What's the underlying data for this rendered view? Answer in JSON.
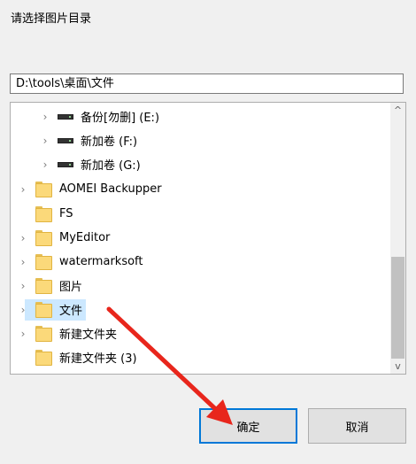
{
  "prompt": "请选择图片目录",
  "path": "D:\\tools\\桌面\\文件",
  "tree": {
    "items": [
      {
        "label": "备份[勿删] (E:)",
        "type": "drive",
        "chevron": "›"
      },
      {
        "label": "新加卷 (F:)",
        "type": "drive",
        "chevron": "›"
      },
      {
        "label": "新加卷 (G:)",
        "type": "drive",
        "chevron": "›"
      },
      {
        "label": "AOMEI Backupper",
        "type": "folder",
        "chevron": "›"
      },
      {
        "label": "FS",
        "type": "folder",
        "chevron": ""
      },
      {
        "label": "MyEditor",
        "type": "folder",
        "chevron": "›"
      },
      {
        "label": "watermarksoft",
        "type": "folder",
        "chevron": "›"
      },
      {
        "label": "图片",
        "type": "folder",
        "chevron": "›"
      },
      {
        "label": "文件",
        "type": "folder",
        "chevron": "›",
        "selected": true
      },
      {
        "label": "新建文件夹",
        "type": "folder",
        "chevron": "›"
      },
      {
        "label": "新建文件夹 (3)",
        "type": "folder",
        "chevron": ""
      }
    ]
  },
  "scroll": {
    "up_glyph": "^",
    "down_glyph": "v"
  },
  "buttons": {
    "ok": "确定",
    "cancel": "取消"
  },
  "colors": {
    "accent": "#0078d7",
    "selection": "#cce8ff",
    "annotation_arrow": "#e8261c"
  }
}
